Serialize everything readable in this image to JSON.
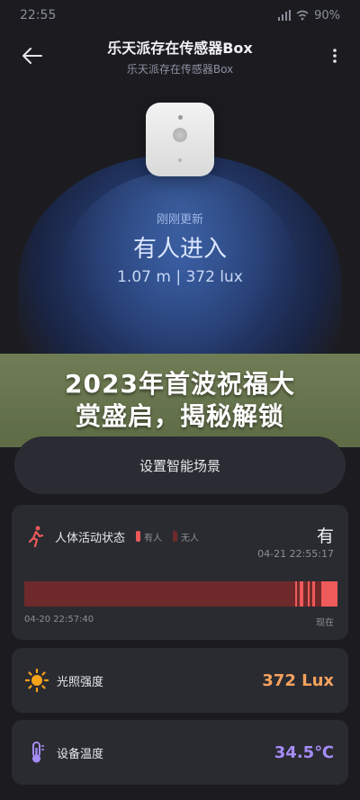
{
  "status_bar": {
    "time": "22:55",
    "battery": "90%"
  },
  "header": {
    "title": "乐天派存在传感器Box",
    "subtitle": "乐天派存在传感器Box"
  },
  "hero": {
    "updated": "刚刚更新",
    "state": "有人进入",
    "readings": "1.07  m | 372 lux"
  },
  "banner": {
    "line1": "2023年首波祝福大",
    "line2": "赏盛启，揭秘解锁"
  },
  "scene_button": {
    "label": "设置智能场景"
  },
  "activity": {
    "label": "人体活动状态",
    "legend_present": "有人",
    "legend_absent": "无人",
    "value": "有",
    "time": "04-21 22:55:17",
    "start_time": "04-20 22:57:40",
    "end_label": "现在",
    "colors": {
      "present": "#ef5a5a",
      "absent": "#6e2a2a"
    }
  },
  "light": {
    "label": "光照强度",
    "value": "372 Lux",
    "icon": "sun-icon",
    "color": "#f5a25d"
  },
  "temperature": {
    "label": "设备温度",
    "value": "34.5℃",
    "icon": "thermometer-icon",
    "color": "#a58cf5"
  }
}
